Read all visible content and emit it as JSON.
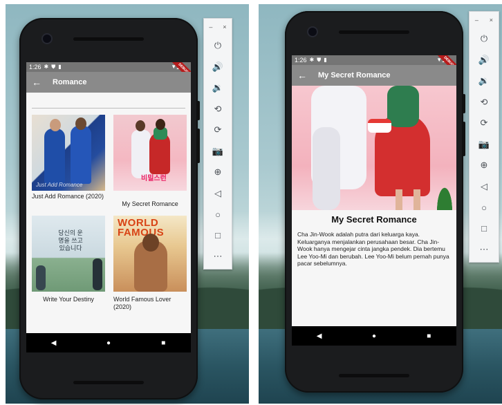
{
  "status": {
    "time": "1:26"
  },
  "debug_banner": "DEBUG",
  "list_screen": {
    "title": "Romance",
    "movies": [
      {
        "title": "Just Add Romance (2020)",
        "poster_text": "Just Add Romance"
      },
      {
        "title": "My Secret Romance",
        "poster_text": "비밀스런"
      },
      {
        "title": "Write Your Destiny",
        "poster_text": "당신의 운명을 쓰고 있습니다"
      },
      {
        "title": "World Famous Lover (2020)",
        "poster_text": "WORLD FAMOUS"
      }
    ]
  },
  "detail_screen": {
    "title": "My Secret Romance",
    "heading": "My Secret Romance",
    "description": "Cha Jin-Wook adalah putra dari keluarga kaya. Keluarganya menjalankan perusahaan besar. Cha Jin-Wook hanya mengejar cinta jangka pendek. Dia bertemu Lee Yoo-Mi dan berubah. Lee Yoo-Mi belum pernah punya pacar sebelumnya."
  },
  "emulator_toolbar": {
    "icons": [
      "power-icon",
      "volume-up-icon",
      "volume-down-icon",
      "rotate-left-icon",
      "rotate-right-icon",
      "camera-icon",
      "zoom-icon",
      "back-icon",
      "home-icon",
      "overview-icon",
      "more-icon"
    ]
  }
}
